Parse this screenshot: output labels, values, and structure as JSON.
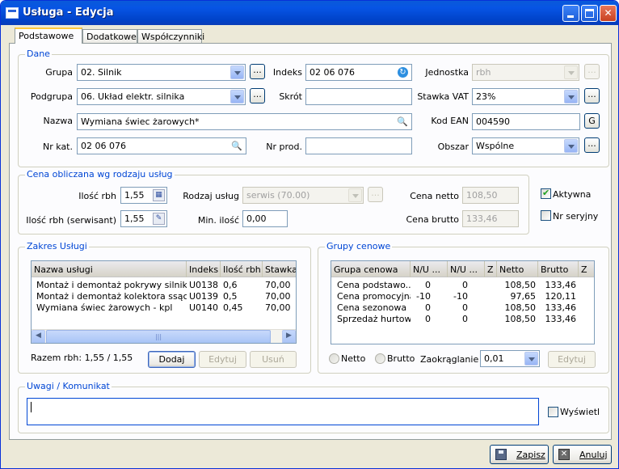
{
  "window": {
    "title": "Usługa - Edycja"
  },
  "tabs": [
    {
      "label": "Podstawowe"
    },
    {
      "label": "Dodatkowe"
    },
    {
      "label": "Współczynniki"
    }
  ],
  "dane": {
    "title": "Dane",
    "grupa": {
      "label": "Grupa",
      "value": "02. Silnik"
    },
    "podgrupa": {
      "label": "Podgrupa",
      "value": "06. Układ elektr. silnika"
    },
    "nazwa": {
      "label": "Nazwa",
      "value": "Wymiana świec żarowych*"
    },
    "nr_kat": {
      "label": "Nr kat.",
      "value": "02 06 076"
    },
    "indeks": {
      "label": "Indeks",
      "value": "02 06 076"
    },
    "skrot": {
      "label": "Skrót",
      "value": ""
    },
    "nr_prod": {
      "label": "Nr prod.",
      "value": ""
    },
    "jednostka": {
      "label": "Jednostka",
      "value": "rbh"
    },
    "stawka_vat": {
      "label": "Stawka VAT",
      "value": "23%"
    },
    "kod_ean": {
      "label": "Kod EAN",
      "value": "004590",
      "button": "G"
    },
    "obszar": {
      "label": "Obszar",
      "value": "Wspólne"
    },
    "dots": "..."
  },
  "cena": {
    "title": "Cena obliczana wg rodzaju usług",
    "ilosc_rbh": {
      "label": "Ilość rbh",
      "value": "1,55"
    },
    "ilosc_rbh_serw": {
      "label": "Ilość rbh (serwisant)",
      "value": "1,55"
    },
    "rodzaj_uslug": {
      "label": "Rodzaj usług",
      "value": "serwis (70.00)"
    },
    "min_ilosc": {
      "label": "Min. ilość",
      "value": "0,00"
    },
    "cena_netto": {
      "label": "Cena netto",
      "value": "108,50"
    },
    "cena_brutto": {
      "label": "Cena brutto",
      "value": "133,46"
    }
  },
  "flags": {
    "aktywna": "Aktywna",
    "nr_seryjny": "Nr seryjny"
  },
  "zakres": {
    "title": "Zakres Usługi",
    "columns": [
      "Nazwa usługi",
      "Indeks",
      "Ilość rbh",
      "Stawka"
    ],
    "rows": [
      [
        "Montaż i demontaż pokrywy silnika",
        "U0138",
        "0,6",
        "70,00"
      ],
      [
        "Montaż i demontaż kolektora ssącego",
        "U0139",
        "0,5",
        "70,00"
      ],
      [
        "Wymiana świec żarowych - kpl",
        "U0140",
        "0,45",
        "70,00"
      ]
    ],
    "razem": "Razem rbh: 1,55 / 1,55",
    "buttons": {
      "dodaj": "Dodaj",
      "edytuj": "Edytuj",
      "usun": "Usuń"
    }
  },
  "grupy": {
    "title": "Grupy cenowe",
    "columns": [
      "Grupa cenowa",
      "N/U ...",
      "N/U ...",
      "Z",
      "Netto",
      "Brutto",
      "Z"
    ],
    "rows": [
      [
        "Cena podstawo...",
        "0",
        "0",
        "",
        "108,50",
        "133,46",
        ""
      ],
      [
        "Cena promocyjna",
        "-10",
        "-10",
        "",
        "97,65",
        "120,11",
        ""
      ],
      [
        "Cena sezonowa",
        "0",
        "0",
        "",
        "108,50",
        "133,46",
        ""
      ],
      [
        "Sprzedaż hurtowa",
        "0",
        "0",
        "",
        "108,50",
        "133,46",
        ""
      ]
    ],
    "netto": "Netto",
    "brutto": "Brutto",
    "zaokraglanie": {
      "label": "Zaokrąglanie",
      "value": "0,01"
    },
    "edytuj": "Edytuj"
  },
  "uwagi": {
    "title": "Uwagi / Komunikat",
    "value": "",
    "wyswietl": "Wyświetl"
  },
  "footer": {
    "zapisz": "Zapisz",
    "anuluj": "Anuluj"
  }
}
